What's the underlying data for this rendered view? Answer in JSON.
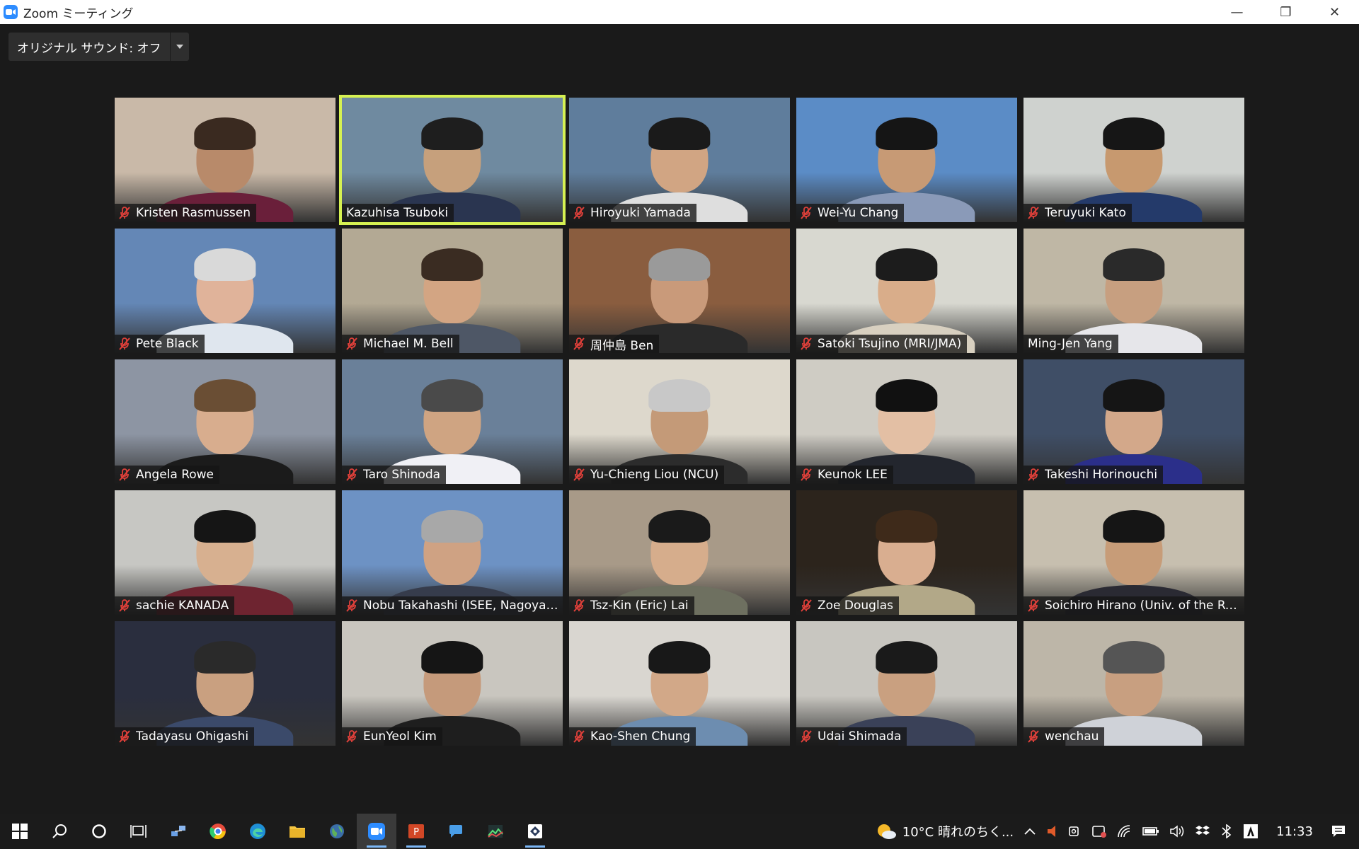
{
  "window": {
    "title": "Zoom ミーティング",
    "minimize_glyph": "—",
    "restore_glyph": "❐",
    "close_glyph": "✕"
  },
  "audio_toggle": {
    "label": "オリジナル サウンド: オフ"
  },
  "active_speaker": "Kazuhisa Tsuboki",
  "participants": [
    {
      "name": "Kristen Rasmussen",
      "muted": true,
      "bg": "#c9b9a8",
      "skin": "#b88a6a",
      "hair": "#3a2a20",
      "shirt": "#6a1f3a"
    },
    {
      "name": "Kazuhisa Tsuboki",
      "muted": false,
      "bg": "#6f8aa0",
      "skin": "#c6a07c",
      "hair": "#1e1e1e",
      "shirt": "#2a3550"
    },
    {
      "name": "Hiroyuki Yamada",
      "muted": true,
      "bg": "#5f7d9c",
      "skin": "#d1a583",
      "hair": "#1a1a1a",
      "shirt": "#dedede"
    },
    {
      "name": "Wei-Yu Chang",
      "muted": true,
      "bg": "#5b8cc6",
      "skin": "#c79a75",
      "hair": "#151515",
      "shirt": "#8a9ab8"
    },
    {
      "name": "Teruyuki Kato",
      "muted": true,
      "bg": "#cfd2cf",
      "skin": "#c7996f",
      "hair": "#161616",
      "shirt": "#243a6a"
    },
    {
      "name": "Pete Black",
      "muted": true,
      "bg": "#6487b6",
      "skin": "#e0b39a",
      "hair": "#d9d9d9",
      "shirt": "#dfe6ee"
    },
    {
      "name": "Michael M. Bell",
      "muted": true,
      "bg": "#b3a994",
      "skin": "#d3a583",
      "hair": "#3a2c22",
      "shirt": "#4e5766"
    },
    {
      "name": "周仲島 Ben",
      "muted": true,
      "bg": "#8a5d3f",
      "skin": "#c99a7a",
      "hair": "#9a9a9a",
      "shirt": "#2a2a2a"
    },
    {
      "name": "Satoki Tsujino (MRI/JMA)",
      "muted": true,
      "bg": "#d8d8d0",
      "skin": "#d9ad8a",
      "hair": "#1c1c1c",
      "shirt": "#d8d0c0"
    },
    {
      "name": "Ming-Jen Yang",
      "muted": false,
      "bg": "#bfb7a5",
      "skin": "#c79f80",
      "hair": "#2a2a2a",
      "shirt": "#e6e6ea"
    },
    {
      "name": "Angela Rowe",
      "muted": true,
      "bg": "#8d95a3",
      "skin": "#d8ad8e",
      "hair": "#6a4e34",
      "shirt": "#1b1b1b"
    },
    {
      "name": "Taro Shinoda",
      "muted": true,
      "bg": "#6a8099",
      "skin": "#cfa482",
      "hair": "#4a4a4a",
      "shirt": "#f0f0f5"
    },
    {
      "name": "Yu-Chieng Liou (NCU)",
      "muted": true,
      "bg": "#ddd8cc",
      "skin": "#c49a78",
      "hair": "#c8c8c8",
      "shirt": "#2c2c2c"
    },
    {
      "name": "Keunok LEE",
      "muted": true,
      "bg": "#cfccc4",
      "skin": "#e3bfa4",
      "hair": "#111111",
      "shirt": "#23262e"
    },
    {
      "name": "Takeshi Horinouchi",
      "muted": true,
      "bg": "#3f4e66",
      "skin": "#d3a88a",
      "hair": "#151515",
      "shirt": "#2b2f8a"
    },
    {
      "name": "sachie KANADA",
      "muted": true,
      "bg": "#c7c7c3",
      "skin": "#d7b090",
      "hair": "#151515",
      "shirt": "#6e2430"
    },
    {
      "name": "Nobu Takahashi (ISEE, Nagoya ...",
      "muted": true,
      "bg": "#6d92c4",
      "skin": "#cfa283",
      "hair": "#a8a8a8",
      "shirt": "#363c4c"
    },
    {
      "name": "Tsz-Kin (Eric) Lai",
      "muted": true,
      "bg": "#a89a88",
      "skin": "#d6ad8c",
      "hair": "#1a1a1a",
      "shirt": "#6e7060"
    },
    {
      "name": "Zoe Douglas",
      "muted": true,
      "bg": "#2c241c",
      "skin": "#d9ae90",
      "hair": "#3e2a1a",
      "shirt": "#b2a888"
    },
    {
      "name": "Soichiro Hirano (Univ. of the Ry...",
      "muted": true,
      "bg": "#c7bfaf",
      "skin": "#c79c78",
      "hair": "#151515",
      "shirt": "#2a2a33"
    },
    {
      "name": "Tadayasu Ohigashi",
      "muted": true,
      "bg": "#2a2e3e",
      "skin": "#c9a080",
      "hair": "#2a2a2a",
      "shirt": "#3b4a6a"
    },
    {
      "name": "EunYeol Kim",
      "muted": true,
      "bg": "#c9c6bf",
      "skin": "#c59a7b",
      "hair": "#151515",
      "shirt": "#1e1e1e"
    },
    {
      "name": "Kao-Shen Chung",
      "muted": true,
      "bg": "#d9d6d0",
      "skin": "#d2a888",
      "hair": "#181818",
      "shirt": "#6d8db0"
    },
    {
      "name": "Udai Shimada",
      "muted": true,
      "bg": "#c8c6c0",
      "skin": "#c9a080",
      "hair": "#1a1a1a",
      "shirt": "#3a4158"
    },
    {
      "name": "wenchau",
      "muted": true,
      "bg": "#bdb6a8",
      "skin": "#c89f80",
      "hair": "#555555",
      "shirt": "#cfd2d8"
    }
  ],
  "taskbar": {
    "weather": "10°C  晴れのちく...",
    "clock": "11:33"
  },
  "colors": {
    "accent_active": "#d6f152",
    "muted_red": "#e0403a"
  }
}
